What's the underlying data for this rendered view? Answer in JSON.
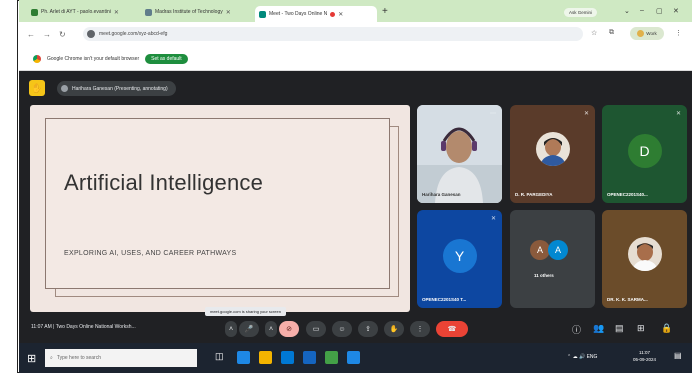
{
  "browser": {
    "tabs": [
      {
        "label": "Ph. Arlet di AYT - paolo.evantini"
      },
      {
        "label": "Madras Institute of Technology"
      },
      {
        "label": "Meet - Two Days Online N"
      }
    ],
    "share_button": "Ask Gemini",
    "url": "meet.google.com/xyz-abcd-efg",
    "profile_label": "Work"
  },
  "infobar": {
    "message": "Google Chrome isn't your default browser",
    "button": "Set as default"
  },
  "meet": {
    "presenting_label": "Harihara Ganesan (Presenting, annotating)",
    "slide": {
      "title": "Artificial Intelligence",
      "subtitle": "EXPLORING AI, USES, AND CAREER PATHWAYS"
    },
    "participants": [
      {
        "name": "Harihara Ganesan",
        "type": "video",
        "bg": "#c9d3dc"
      },
      {
        "name": "D. R. PARGEDIYA",
        "type": "photo",
        "bg": "#5a3b2a"
      },
      {
        "name": "OPENEC2201S40...",
        "type": "letter",
        "letter": "D",
        "bg": "#1e5631",
        "avatar_color": "#2e7d32"
      },
      {
        "name": "OPENEC2201S40 T...",
        "type": "letter",
        "letter": "Y",
        "bg": "#0d47a1",
        "avatar_color": "#1976d2"
      },
      {
        "name": "11 others",
        "type": "group",
        "bg": "#3c4043"
      },
      {
        "name": "DR. K. K. SARMA...",
        "type": "photo",
        "bg": "#6b4c2a"
      }
    ],
    "group_letters": [
      "A",
      "A"
    ],
    "toolbar": {
      "time": "11:07 AM",
      "meeting_name": "Two Days Online National Worksh...",
      "tooltip": "meet.google.com is sharing your screen"
    }
  },
  "taskbar": {
    "search_placeholder": "Type here to search",
    "time": "11:07",
    "date": "05-09-2024"
  },
  "colors": {
    "meet_bg": "#202124",
    "end_call": "#ea4335",
    "tabstrip": "#cfe9c3",
    "slide_bg": "#f1e6e1"
  }
}
